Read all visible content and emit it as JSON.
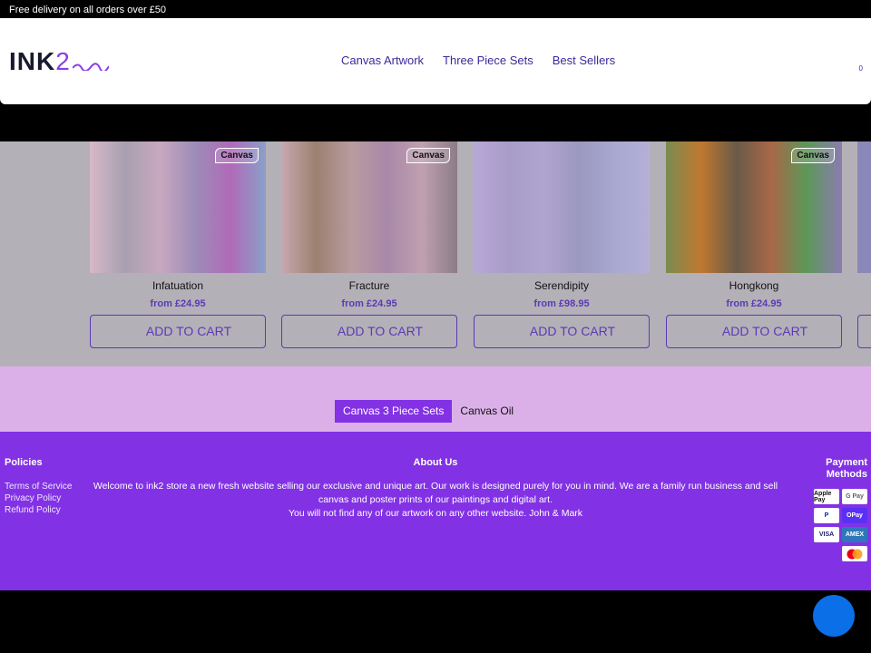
{
  "announcement": "Free delivery on all orders over £50",
  "header": {
    "logo": {
      "main": "INK",
      "accent": "2"
    },
    "nav": [
      "Canvas Artwork",
      "Three Piece Sets",
      "Best Sellers"
    ],
    "cart_count": "0"
  },
  "products": [
    {
      "title": "Infatuation",
      "price": "from £24.95",
      "badge": "Canvas",
      "button": "ADD TO CART",
      "colors": [
        "#d8b8c8",
        "#a8a0b0",
        "#c8a8c0",
        "#9c8cb8",
        "#b06ab8",
        "#8aa0c8"
      ]
    },
    {
      "title": "Fracture",
      "price": "from £24.95",
      "badge": "Canvas",
      "button": "ADD TO CART",
      "colors": [
        "#c8a8b0",
        "#9c8070",
        "#b89ca0",
        "#a888a8",
        "#c0a0b0",
        "#8c7c88"
      ]
    },
    {
      "title": "Serendipity",
      "price": "from £98.95",
      "badge": "",
      "button": "ADD TO CART",
      "colors": [
        "#b8a8d8",
        "#a89cc8",
        "#b0a4d0",
        "#9c98c0",
        "#a8a8d0",
        "#b4b0d8"
      ]
    },
    {
      "title": "Hongkong",
      "price": "from £24.95",
      "badge": "Canvas",
      "button": "ADD TO CART",
      "colors": [
        "#7a8c50",
        "#c07830",
        "#6a5a48",
        "#a86848",
        "#5c9858",
        "#8a7cb0"
      ]
    }
  ],
  "categories": {
    "items": [
      "Canvas 3 Piece Sets",
      "Canvas Oil"
    ],
    "active": "Canvas 3 Piece Sets"
  },
  "footer": {
    "policies": {
      "heading": "Policies",
      "links": [
        "Terms of Service",
        "Privacy Policy",
        "Refund Policy"
      ]
    },
    "about": {
      "heading": "About Us",
      "text1": "Welcome to ink2 store a new fresh website selling our exclusive and unique art. Our work is designed purely for you in mind. We are a family run business and sell canvas and poster prints of our paintings and digital art.",
      "text2": "You will not find any of our artwork on any other website. John & Mark"
    },
    "payments": {
      "heading": "Payment Methods",
      "methods": [
        "Apple Pay",
        "G Pay",
        "P",
        "OPay",
        "VISA",
        "AMEX",
        "mastercard"
      ]
    }
  },
  "colors": {
    "accent": "#8232e4",
    "link": "#3b2a9c",
    "price": "#5b3ab4",
    "chat": "#0b6fe8"
  }
}
